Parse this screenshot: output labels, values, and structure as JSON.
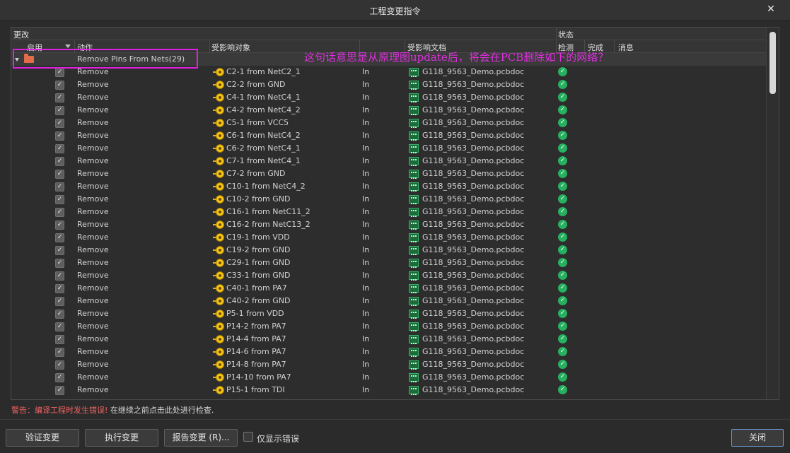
{
  "window": {
    "title": "工程变更指令"
  },
  "columns": {
    "modifications": "更改",
    "status": "状态",
    "enable": "启用",
    "action": "动作",
    "affected_object": "受影响对象",
    "affected_document": "受影响文档",
    "check": "检测",
    "done": "完成",
    "message": "消息"
  },
  "group": {
    "label": "Remove Pins From Nets(29)"
  },
  "rows": [
    {
      "action": "Remove",
      "object": "C2-1 from NetC2_1",
      "dir": "In",
      "document": "G118_9563_Demo.pcbdoc"
    },
    {
      "action": "Remove",
      "object": "C2-2 from GND",
      "dir": "In",
      "document": "G118_9563_Demo.pcbdoc"
    },
    {
      "action": "Remove",
      "object": "C4-1 from NetC4_1",
      "dir": "In",
      "document": "G118_9563_Demo.pcbdoc"
    },
    {
      "action": "Remove",
      "object": "C4-2 from NetC4_2",
      "dir": "In",
      "document": "G118_9563_Demo.pcbdoc"
    },
    {
      "action": "Remove",
      "object": "C5-1 from VCC5",
      "dir": "In",
      "document": "G118_9563_Demo.pcbdoc"
    },
    {
      "action": "Remove",
      "object": "C6-1 from NetC4_2",
      "dir": "In",
      "document": "G118_9563_Demo.pcbdoc"
    },
    {
      "action": "Remove",
      "object": "C6-2 from NetC4_1",
      "dir": "In",
      "document": "G118_9563_Demo.pcbdoc"
    },
    {
      "action": "Remove",
      "object": "C7-1 from NetC4_1",
      "dir": "In",
      "document": "G118_9563_Demo.pcbdoc"
    },
    {
      "action": "Remove",
      "object": "C7-2 from GND",
      "dir": "In",
      "document": "G118_9563_Demo.pcbdoc"
    },
    {
      "action": "Remove",
      "object": "C10-1 from NetC4_2",
      "dir": "In",
      "document": "G118_9563_Demo.pcbdoc"
    },
    {
      "action": "Remove",
      "object": "C10-2 from GND",
      "dir": "In",
      "document": "G118_9563_Demo.pcbdoc"
    },
    {
      "action": "Remove",
      "object": "C16-1 from NetC11_2",
      "dir": "In",
      "document": "G118_9563_Demo.pcbdoc"
    },
    {
      "action": "Remove",
      "object": "C16-2 from NetC13_2",
      "dir": "In",
      "document": "G118_9563_Demo.pcbdoc"
    },
    {
      "action": "Remove",
      "object": "C19-1 from VDD",
      "dir": "In",
      "document": "G118_9563_Demo.pcbdoc"
    },
    {
      "action": "Remove",
      "object": "C19-2 from GND",
      "dir": "In",
      "document": "G118_9563_Demo.pcbdoc"
    },
    {
      "action": "Remove",
      "object": "C29-1 from GND",
      "dir": "In",
      "document": "G118_9563_Demo.pcbdoc"
    },
    {
      "action": "Remove",
      "object": "C33-1 from GND",
      "dir": "In",
      "document": "G118_9563_Demo.pcbdoc"
    },
    {
      "action": "Remove",
      "object": "C40-1 from PA7",
      "dir": "In",
      "document": "G118_9563_Demo.pcbdoc"
    },
    {
      "action": "Remove",
      "object": "C40-2 from GND",
      "dir": "In",
      "document": "G118_9563_Demo.pcbdoc"
    },
    {
      "action": "Remove",
      "object": "P5-1 from VDD",
      "dir": "In",
      "document": "G118_9563_Demo.pcbdoc"
    },
    {
      "action": "Remove",
      "object": "P14-2 from PA7",
      "dir": "In",
      "document": "G118_9563_Demo.pcbdoc"
    },
    {
      "action": "Remove",
      "object": "P14-4 from PA7",
      "dir": "In",
      "document": "G118_9563_Demo.pcbdoc"
    },
    {
      "action": "Remove",
      "object": "P14-6 from PA7",
      "dir": "In",
      "document": "G118_9563_Demo.pcbdoc"
    },
    {
      "action": "Remove",
      "object": "P14-8 from PA7",
      "dir": "In",
      "document": "G118_9563_Demo.pcbdoc"
    },
    {
      "action": "Remove",
      "object": "P14-10 from PA7",
      "dir": "In",
      "document": "G118_9563_Demo.pcbdoc"
    },
    {
      "action": "Remove",
      "object": "P15-1 from TDI",
      "dir": "In",
      "document": "G118_9563_Demo.pcbdoc"
    }
  ],
  "annotation": "这句话意思是从原理图update后，将会在PCB删除如下的网络？",
  "status_bar": {
    "warning": "警告：编译工程时发生错误!",
    "info": "在继续之前点击此处进行检查."
  },
  "buttons": {
    "validate": "验证变更",
    "execute": "执行变更",
    "report": "报告变更 (R)...",
    "only_errors": "仅显示错误",
    "close": "关闭"
  },
  "icons": {
    "close": "close-icon",
    "expander": "triangle-down-icon",
    "group": "folder-icon",
    "pin": "component-pin-icon",
    "document": "pcb-document-icon",
    "check": "check-circle-icon"
  },
  "colors": {
    "background": "#2b2b2b",
    "highlight": "#e020e0",
    "warning": "#f26262",
    "ok": "#27b060",
    "primary_border": "#6b98d6"
  }
}
